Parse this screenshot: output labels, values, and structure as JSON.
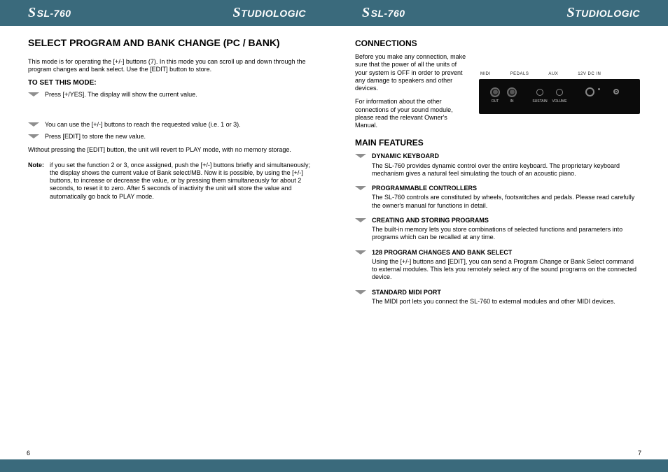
{
  "brand": "STUDIOLOGIC",
  "model": "SL-760",
  "left": {
    "pageno": "6",
    "title": "SELECT PROGRAM AND BANK CHANGE (PC / BANK)",
    "p1": "This mode is for operating the [+/-] buttons (7). In this mode you can scroll up and down through the program changes and bank select. Use the [EDIT] button to store.",
    "sub": "TO SET THIS MODE:",
    "a1": "Press [+/YES]. The display will show the current value.",
    "a2": "You can use the [+/-] buttons to reach the requested value (i.e. 1 or 3).",
    "a3": "Press [EDIT] to store the new value.",
    "p2": "Without pressing the [EDIT] button, the unit will revert to PLAY mode, with no memory storage.",
    "note_lbl": "Note:",
    "note_txt": "if you set the function 2 or 3, once assigned, push the [+/-] buttons briefly and simultaneously; the display shows the current value of Bank select/MB. Now it is possible, by using the [+/-] buttons, to increase or decrease the value, or by pressing them simultaneously for about 2 seconds, to reset it to zero. After 5 seconds of inactivity the unit will store the value and automatically go back to PLAY mode."
  },
  "right": {
    "pageno": "7",
    "title1": "CONNECTIONS",
    "p1": "Before you make any connection, make sure that the power of all the units of your system is OFF in order to prevent any damage to speakers and other devices.",
    "p2": "For information about the other connections of your sound module, please read the relevant Owner's Manual.",
    "labels": {
      "midi": "MIDI",
      "ped": "PEDALS",
      "aux": "AUX",
      "dc": "12V DC IN"
    },
    "panel": {
      "midi_out": "OUT",
      "midi_in": "IN",
      "sust": "SUSTAIN",
      "vol": "VOLUME",
      "aux": " ",
      "dc": " "
    },
    "title2": "MAIN FEATURES",
    "feat": [
      {
        "h": "DYNAMIC KEYBOARD",
        "b": "The SL-760 provides dynamic control over the entire keyboard. The proprietary keyboard mechanism gives a natural feel simulating the touch of an acoustic piano."
      },
      {
        "h": "PROGRAMMABLE CONTROLLERS",
        "b": "The SL-760 controls are constituted by wheels, footswitches and pedals. Please read carefully the owner's manual for functions in detail."
      },
      {
        "h": "CREATING AND STORING PROGRAMS",
        "b": "The built-in memory lets you store combinations of selected functions and parameters into programs which can be recalled at any time."
      },
      {
        "h": "128 PROGRAM CHANGES AND BANK SELECT",
        "b": "Using the [+/-] buttons and [EDIT], you can send a Program Change or Bank Select command to external modules. This lets you remotely select any of the sound programs on the connected device."
      },
      {
        "h": "STANDARD MIDI PORT",
        "b": "The MIDI port lets you connect the SL-760 to external modules and other MIDI devices."
      }
    ]
  }
}
